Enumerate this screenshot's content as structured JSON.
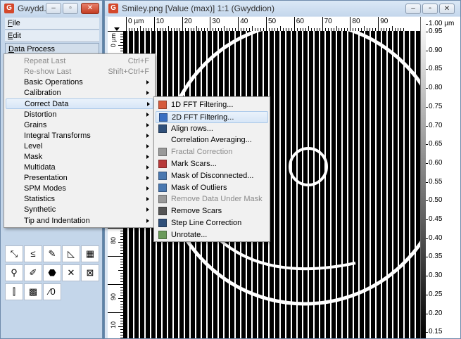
{
  "toolbox": {
    "title": "Gwydd...",
    "menus": [
      {
        "label": "File",
        "key": "F",
        "rest": "ile"
      },
      {
        "label": "Edit",
        "key": "E",
        "rest": "dit"
      },
      {
        "label": "Data Process",
        "key": "D",
        "rest": "ata Process"
      }
    ],
    "tools": [
      "⤡",
      "≤",
      "✎",
      "◺",
      "▦",
      "⚲",
      "✐",
      "⬣",
      "✕",
      "⊠",
      "⫿",
      "▩",
      "⁄0"
    ]
  },
  "data_window": {
    "title": "Smiley.png [Value (max)] 1:1 (Gwyddion)",
    "hruler_labels": [
      "0 µm",
      "10",
      "20",
      "30",
      "40",
      "50",
      "60",
      "70",
      "80",
      "90"
    ],
    "vruler_labels": [
      "0 µm",
      "10",
      "80",
      "90",
      "10"
    ],
    "colorbar_labels": [
      "1.00 µm",
      "0.95",
      "0.90",
      "0.85",
      "0.80",
      "0.75",
      "0.70",
      "0.65",
      "0.60",
      "0.55",
      "0.50",
      "0.45",
      "0.40",
      "0.35",
      "0.30",
      "0.25",
      "0.20",
      "0.15"
    ]
  },
  "data_process_menu": [
    {
      "label": "Repeat Last",
      "accel": "Ctrl+F",
      "disabled": true
    },
    {
      "label": "Re-show Last",
      "accel": "Shift+Ctrl+F",
      "disabled": true
    },
    {
      "label": "Basic Operations",
      "submenu": true
    },
    {
      "label": "Calibration",
      "submenu": true
    },
    {
      "label": "Correct Data",
      "submenu": true,
      "highlighted": true
    },
    {
      "label": "Distortion",
      "submenu": true
    },
    {
      "label": "Grains",
      "submenu": true
    },
    {
      "label": "Integral Transforms",
      "submenu": true
    },
    {
      "label": "Level",
      "submenu": true
    },
    {
      "label": "Mask",
      "submenu": true
    },
    {
      "label": "Multidata",
      "submenu": true
    },
    {
      "label": "Presentation",
      "submenu": true
    },
    {
      "label": "SPM Modes",
      "submenu": true
    },
    {
      "label": "Statistics",
      "submenu": true
    },
    {
      "label": "Synthetic",
      "submenu": true
    },
    {
      "label": "Tip and Indentation",
      "submenu": true
    }
  ],
  "correct_data_menu": [
    {
      "label": "1D FFT Filtering...",
      "icon": "fft1d-icon",
      "color": "#d65a3a"
    },
    {
      "label": "2D FFT Filtering...",
      "icon": "fft2d-icon",
      "color": "#3a6fc2",
      "highlighted": true
    },
    {
      "label": "Align rows...",
      "icon": "align-rows-icon",
      "color": "#30507a"
    },
    {
      "label": "Correlation Averaging...",
      "icon": "",
      "color": ""
    },
    {
      "label": "Fractal Correction",
      "icon": "fractal-icon",
      "color": "#9a9a9a",
      "disabled": true
    },
    {
      "label": "Mark Scars...",
      "icon": "mark-scars-icon",
      "color": "#b83a3a"
    },
    {
      "label": "Mask of Disconnected...",
      "icon": "mask-disconnected-icon",
      "color": "#4a78b0"
    },
    {
      "label": "Mask of Outliers",
      "icon": "mask-outliers-icon",
      "color": "#4a78b0"
    },
    {
      "label": "Remove Data Under Mask",
      "icon": "remove-mask-icon",
      "color": "#9a9a9a",
      "disabled": true
    },
    {
      "label": "Remove Scars",
      "icon": "remove-scars-icon",
      "color": "#555555"
    },
    {
      "label": "Step Line Correction",
      "icon": "step-line-icon",
      "color": "#30507a"
    },
    {
      "label": "Unrotate...",
      "icon": "unrotate-icon",
      "color": "#6a9a5a"
    }
  ],
  "colors": {
    "menu_bg": "#f1f1f1",
    "highlight": "#d7e6f7",
    "desktop": "#5b84a8"
  }
}
